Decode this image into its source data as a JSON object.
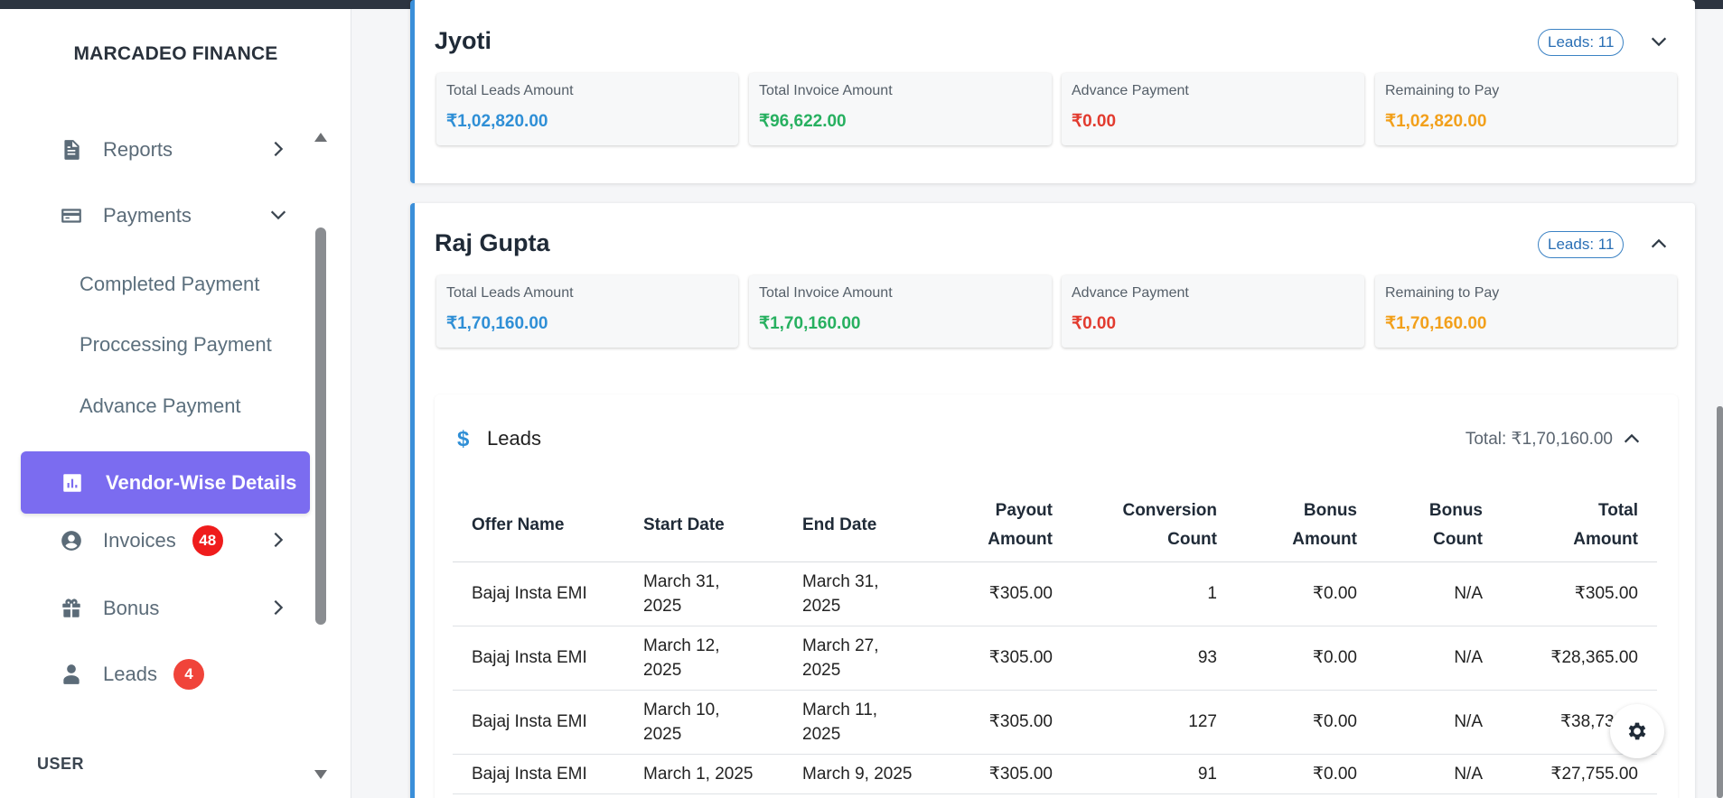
{
  "brand": "MARCADEO FINANCE",
  "sidebar": {
    "items": [
      {
        "label": "Reports",
        "icon": "document-icon"
      },
      {
        "label": "Payments",
        "icon": "card-icon"
      },
      {
        "label": "Vendor-Wise Details",
        "icon": "bar-chart-icon"
      },
      {
        "label": "Invoices",
        "icon": "user-circle-icon",
        "badge": "48"
      },
      {
        "label": "Bonus",
        "icon": "gift-icon"
      },
      {
        "label": "Leads",
        "icon": "person-icon",
        "badge": "4"
      }
    ],
    "payments_sub": [
      "Completed Payment",
      "Proccessing Payment",
      "Advance Payment"
    ],
    "section_user": "USER"
  },
  "vendors": [
    {
      "name": "Jyoti",
      "leads_pill": "Leads: 11",
      "stats": [
        {
          "label": "Total Leads Amount",
          "value": "₹1,02,820.00"
        },
        {
          "label": "Total Invoice Amount",
          "value": "₹96,622.00"
        },
        {
          "label": "Advance Payment",
          "value": "₹0.00"
        },
        {
          "label": "Remaining to Pay",
          "value": "₹1,02,820.00"
        }
      ]
    },
    {
      "name": "Raj Gupta",
      "leads_pill": "Leads: 11",
      "stats": [
        {
          "label": "Total Leads Amount",
          "value": "₹1,70,160.00"
        },
        {
          "label": "Total Invoice Amount",
          "value": "₹1,70,160.00"
        },
        {
          "label": "Advance Payment",
          "value": "₹0.00"
        },
        {
          "label": "Remaining to Pay",
          "value": "₹1,70,160.00"
        }
      ]
    }
  ],
  "leads": {
    "icon": "dollar-icon",
    "title": "Leads",
    "total": "Total: ₹1,70,160.00",
    "headers": {
      "offer_name": "Offer Name",
      "start_date": "Start Date",
      "end_date": "End Date",
      "payout_1": "Payout",
      "payout_2": "Amount",
      "conversion_1": "Conversion",
      "conversion_2": "Count",
      "bonus_amount_1": "Bonus",
      "bonus_amount_2": "Amount",
      "bonus_count_1": "Bonus",
      "bonus_count_2": "Count",
      "total_1": "Total",
      "total_2": "Amount"
    },
    "rows": [
      {
        "offer": "Bajaj Insta EMI",
        "start_1": "March 31,",
        "start_2": "2025",
        "end_1": "March 31,",
        "end_2": "2025",
        "payout": "₹305.00",
        "conversion": "1",
        "bonus_amount": "₹0.00",
        "bonus_count": "N/A",
        "total": "₹305.00"
      },
      {
        "offer": "Bajaj Insta EMI",
        "start_1": "March 12,",
        "start_2": "2025",
        "end_1": "March 27,",
        "end_2": "2025",
        "payout": "₹305.00",
        "conversion": "93",
        "bonus_amount": "₹0.00",
        "bonus_count": "N/A",
        "total": "₹28,365.00"
      },
      {
        "offer": "Bajaj Insta EMI",
        "start_1": "March 10,",
        "start_2": "2025",
        "end_1": "March 11,",
        "end_2": "2025",
        "payout": "₹305.00",
        "conversion": "127",
        "bonus_amount": "₹0.00",
        "bonus_count": "N/A",
        "total": "₹38,735.0"
      },
      {
        "offer": "Bajaj Insta EMI",
        "start_1": "March 1, 2025",
        "start_2": "",
        "end_1": "March 9, 2025",
        "end_2": "",
        "payout": "₹305.00",
        "conversion": "91",
        "bonus_amount": "₹0.00",
        "bonus_count": "N/A",
        "total": "₹27,755.00"
      }
    ]
  },
  "colors": {
    "accent": "#7b6cf0",
    "card_border": "#3b8fd9",
    "blue": "#2f8fd6",
    "green": "#27b060",
    "red": "#e23b2f",
    "orange": "#f2a01b"
  }
}
